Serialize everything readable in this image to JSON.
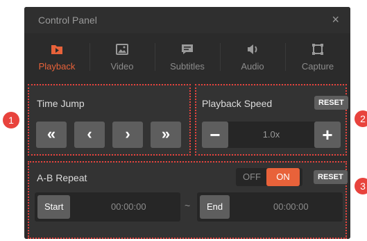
{
  "window": {
    "title": "Control Panel",
    "close_glyph": "×"
  },
  "tabs": [
    {
      "label": "Playback",
      "icon": "play-icon",
      "active": true
    },
    {
      "label": "Video",
      "icon": "image-icon",
      "active": false
    },
    {
      "label": "Subtitles",
      "icon": "subtitles-icon",
      "active": false
    },
    {
      "label": "Audio",
      "icon": "speaker-icon",
      "active": false
    },
    {
      "label": "Capture",
      "icon": "capture-icon",
      "active": false
    }
  ],
  "time_jump": {
    "label": "Time Jump",
    "buttons": [
      "«",
      "‹",
      "›",
      "»"
    ]
  },
  "playback_speed": {
    "label": "Playback Speed",
    "reset_label": "RESET",
    "value": "1.0x",
    "minus_glyph": "−",
    "plus_glyph": "+"
  },
  "ab_repeat": {
    "label": "A-B Repeat",
    "toggle_off": "OFF",
    "toggle_on": "ON",
    "toggle_state": "ON",
    "reset_label": "RESET",
    "start_label": "Start",
    "start_value": "00:00:00",
    "separator": "~",
    "end_label": "End",
    "end_value": "00:00:00"
  },
  "callouts": [
    "1",
    "2",
    "3"
  ],
  "colors": {
    "accent": "#e8623a",
    "callout": "#e8433d",
    "panel_bg": "#2b2b2b",
    "section_bg": "#333333",
    "button_bg": "#5e5e5e"
  }
}
